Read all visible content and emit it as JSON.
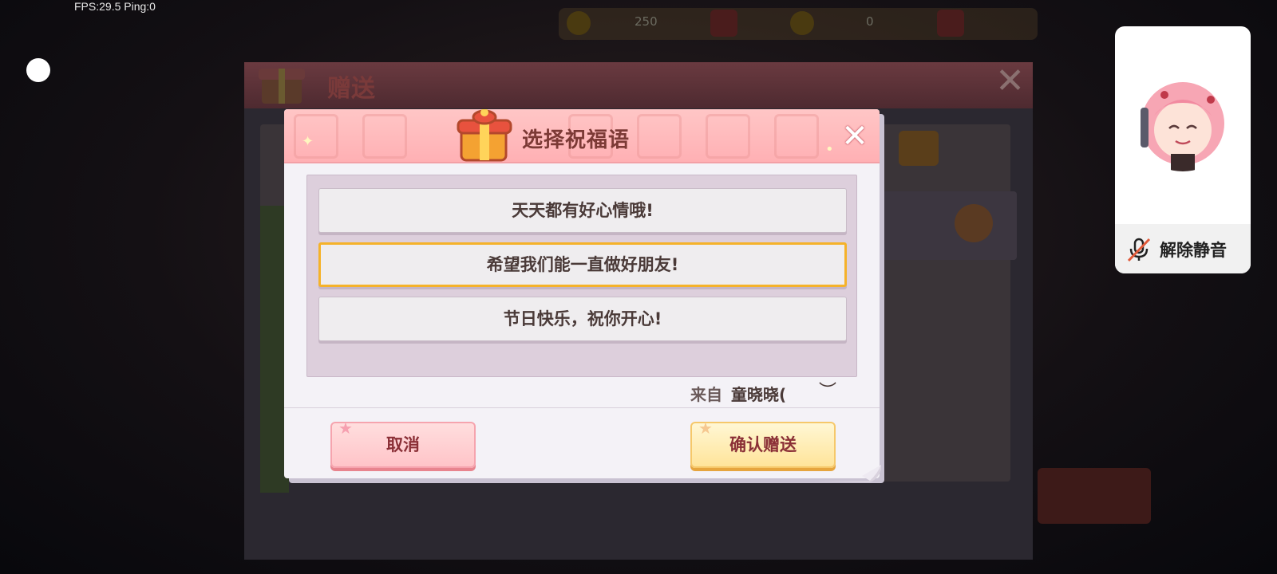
{
  "hud": {
    "fps_text": "FPS:29.5  Ping:0",
    "coins": "250",
    "gems": "0"
  },
  "back_panel": {
    "title": "赠送"
  },
  "dialog": {
    "title": "选择祝福语",
    "close_symbol": "✕",
    "wishes": [
      {
        "label": "天天都有好心情哦!",
        "selected": false
      },
      {
        "label": "希望我们能一直做好朋友!",
        "selected": true
      },
      {
        "label": "节日快乐，祝你开心!",
        "selected": false
      }
    ],
    "from_label": "来自",
    "from_name": "童晓晓(",
    "cancel_label": "取消",
    "confirm_label": "确认赠送"
  },
  "voice_card": {
    "unmute_label": "解除静音"
  },
  "colors": {
    "header_pink": "#ffb0b4",
    "selected_border": "#f5b22a",
    "title_text": "#7c3a36",
    "cancel_bg": "#ffc4c8",
    "confirm_bg": "#ffe49a"
  }
}
